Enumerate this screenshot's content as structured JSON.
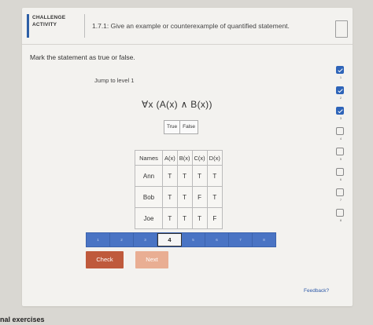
{
  "header": {
    "challenge_label": "CHALLENGE ACTIVITY",
    "title": "1.7.1: Give an example or counterexample of quantified statement."
  },
  "instruction": "Mark the statement as true or false.",
  "jump_label": "Jump to level 1",
  "formula": "∀x (A(x) ∧ B(x))",
  "options": {
    "true_label": "True",
    "false_label": "False"
  },
  "table": {
    "headers": [
      "Names",
      "A(x)",
      "B(x)",
      "C(x)",
      "D(x)"
    ],
    "rows": [
      [
        "Ann",
        "T",
        "T",
        "T",
        "T"
      ],
      [
        "Bob",
        "T",
        "T",
        "F",
        "T"
      ],
      [
        "Joe",
        "T",
        "T",
        "T",
        "F"
      ]
    ]
  },
  "progress": {
    "segments": [
      "1",
      "2",
      "3",
      "4",
      "5",
      "6",
      "7",
      "8"
    ],
    "current": "4"
  },
  "buttons": {
    "check": "Check",
    "next": "Next"
  },
  "feedback_link": "Feedback?",
  "levels": [
    {
      "num": "1",
      "done": true
    },
    {
      "num": "2",
      "done": true
    },
    {
      "num": "3",
      "done": true
    },
    {
      "num": "4",
      "done": false
    },
    {
      "num": "5",
      "done": false
    },
    {
      "num": "6",
      "done": false
    },
    {
      "num": "7",
      "done": false
    },
    {
      "num": "8",
      "done": false
    }
  ],
  "footer_text": "nal exercises",
  "colors": {
    "accent": "#2e64b8",
    "check": "#bf5a3c",
    "next": "#e9ae93",
    "progress": "#4a74c4"
  }
}
